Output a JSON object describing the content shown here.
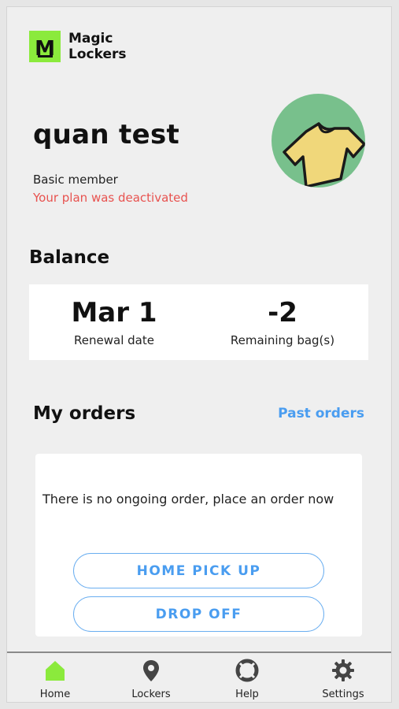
{
  "brand": {
    "logo_glyph": "M",
    "name": "Magic Lockers",
    "accent_color": "#8bea3c"
  },
  "profile": {
    "name": "quan test",
    "plan": "Basic member",
    "plan_status": "Your plan was deactivated",
    "plan_status_color": "#e8524f",
    "avatar_icon": "t-shirt-icon"
  },
  "balance": {
    "title": "Balance",
    "renewal_value": "Mar 1",
    "renewal_label": "Renewal date",
    "bags_value": "-2",
    "bags_label": "Remaining bag(s)"
  },
  "orders": {
    "title": "My orders",
    "past_orders_link": "Past orders",
    "empty_message": "There is no ongoing order, place an order now",
    "home_pickup_button": "HOME PICK UP",
    "drop_off_button": "DROP OFF",
    "link_color": "#4a9df0"
  },
  "nav": {
    "active_color": "#8bea3c",
    "items": [
      {
        "label": "Home",
        "icon": "home-icon",
        "active": true
      },
      {
        "label": "Lockers",
        "icon": "map-pin-icon",
        "active": false
      },
      {
        "label": "Help",
        "icon": "lifebuoy-icon",
        "active": false
      },
      {
        "label": "Settings",
        "icon": "gear-icon",
        "active": false
      }
    ]
  }
}
